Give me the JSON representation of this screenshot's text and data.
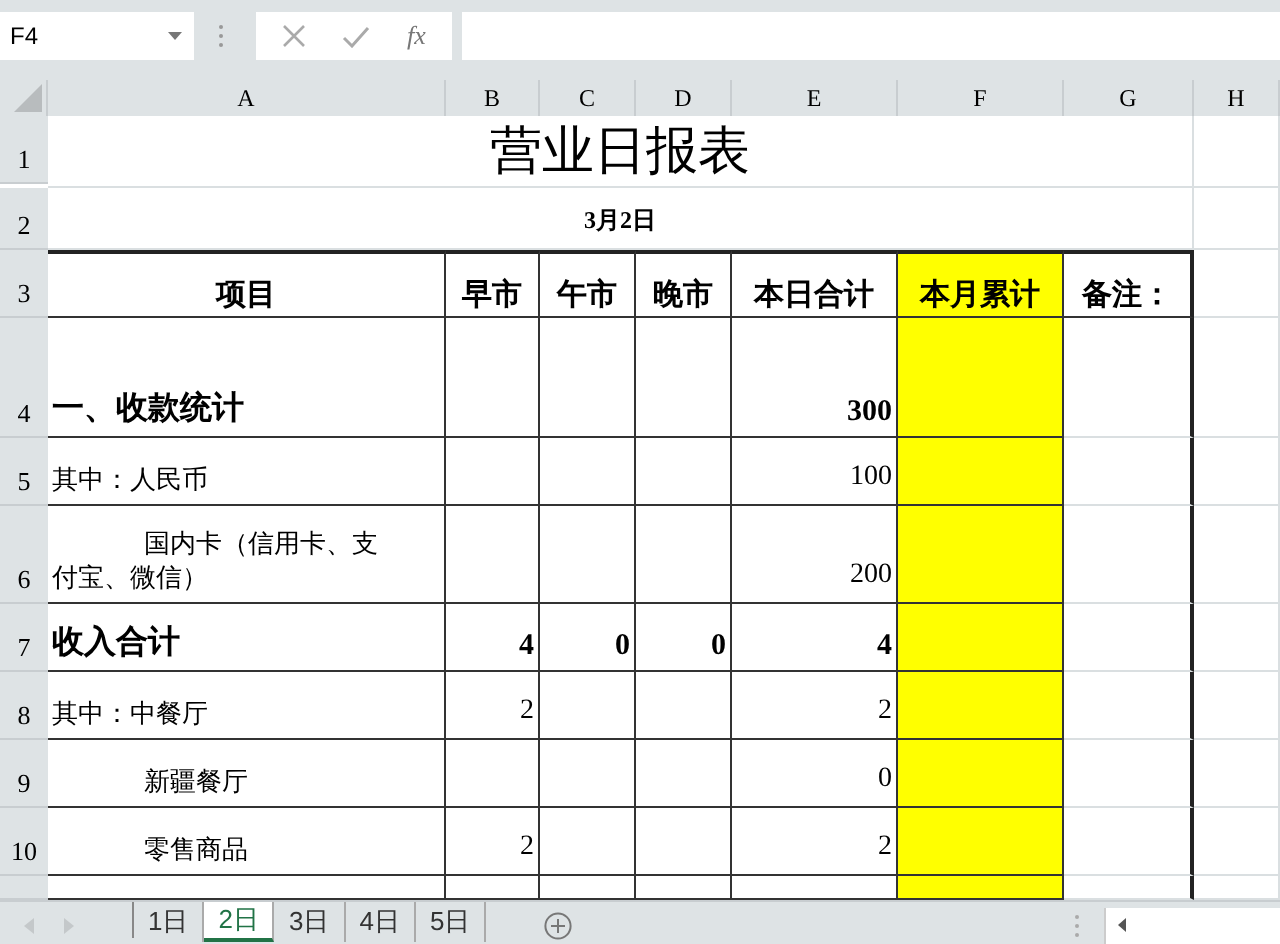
{
  "formula_bar": {
    "name_box": "F4",
    "function_button": "fx"
  },
  "columns": [
    {
      "label": "A"
    },
    {
      "label": "B"
    },
    {
      "label": "C"
    },
    {
      "label": "D"
    },
    {
      "label": "E"
    },
    {
      "label": "F",
      "color": "#ffff00"
    },
    {
      "label": "G"
    },
    {
      "label": "H"
    }
  ],
  "rows": [
    {
      "number": "1",
      "kind": "title",
      "cells": {
        "A": "营业日报表"
      }
    },
    {
      "number": "2",
      "kind": "date",
      "cells": {
        "A": "3月2日"
      }
    },
    {
      "number": "3",
      "kind": "header",
      "cells": {
        "A": "项目",
        "B": "早市",
        "C": "午市",
        "D": "晚市",
        "E": "本日合计",
        "F": "本月累计",
        "G": "备注："
      }
    },
    {
      "number": "4",
      "kind": "section",
      "cells": {
        "A": "一、收款统计",
        "E": "300"
      }
    },
    {
      "number": "5",
      "kind": "item",
      "indent": false,
      "cells": {
        "A": "其中：人民币",
        "E": "100"
      }
    },
    {
      "number": "6",
      "kind": "item",
      "indent": true,
      "cells": {
        "A": "国内卡（信用卡、支付宝、微信）",
        "E": "200"
      }
    },
    {
      "number": "7",
      "kind": "section",
      "cells": {
        "A": "收入合计",
        "B": "4",
        "C": "0",
        "D": "0",
        "E": "4"
      }
    },
    {
      "number": "8",
      "kind": "item",
      "indent": false,
      "cells": {
        "A": "其中：中餐厅",
        "B": "2",
        "E": "2"
      }
    },
    {
      "number": "9",
      "kind": "item",
      "indent": true,
      "cells": {
        "A": "新疆餐厅",
        "E": "0"
      }
    },
    {
      "number": "10",
      "kind": "item",
      "indent": true,
      "cells": {
        "A": "零售商品",
        "B": "2",
        "E": "2"
      }
    },
    {
      "kind": "partial",
      "cells": {}
    }
  ],
  "sheet_tabs": [
    {
      "label": "1日",
      "selected": false
    },
    {
      "label": "2日",
      "selected": true
    },
    {
      "label": "3日",
      "selected": false
    },
    {
      "label": "4日",
      "selected": false
    },
    {
      "label": "5日",
      "selected": false
    }
  ]
}
